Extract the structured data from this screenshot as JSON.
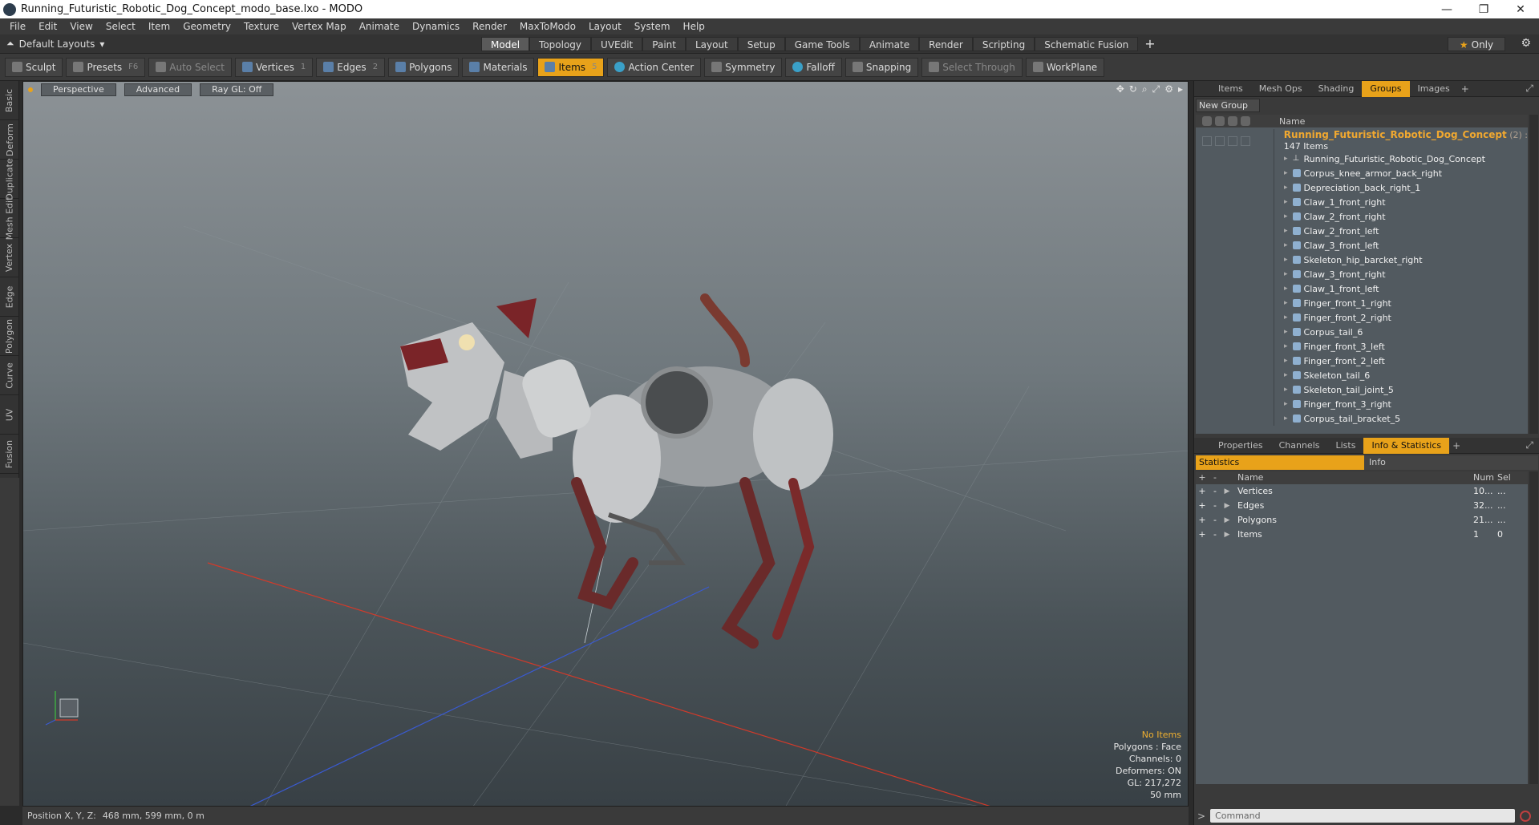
{
  "window": {
    "title": "Running_Futuristic_Robotic_Dog_Concept_modo_base.lxo - MODO",
    "minimize": "—",
    "maximize": "❐",
    "close": "✕"
  },
  "menu": [
    "File",
    "Edit",
    "View",
    "Select",
    "Item",
    "Geometry",
    "Texture",
    "Vertex Map",
    "Animate",
    "Dynamics",
    "Render",
    "MaxToModo",
    "Layout",
    "System",
    "Help"
  ],
  "layoutbar": {
    "layouts_label": "Default Layouts",
    "tabs": [
      "Model",
      "Topology",
      "UVEdit",
      "Paint",
      "Layout",
      "Setup",
      "Game Tools",
      "Animate",
      "Render",
      "Scripting",
      "Schematic Fusion"
    ],
    "active_tab": "Model",
    "plus": "+",
    "only_label": "Only",
    "only_star": "★"
  },
  "toolbar": {
    "sculpt": "Sculpt",
    "presets": "Presets",
    "presets_key": "F6",
    "auto_select": "Auto Select",
    "vertices": "Vertices",
    "vertices_key": "1",
    "edges": "Edges",
    "edges_key": "2",
    "polygons": "Polygons",
    "materials": "Materials",
    "items": "Items",
    "items_key": "5",
    "action_center": "Action Center",
    "symmetry": "Symmetry",
    "falloff": "Falloff",
    "snapping": "Snapping",
    "select_through": "Select Through",
    "workplane": "WorkPlane"
  },
  "left_tabs": [
    "Basic",
    "Deform",
    "Duplicate",
    "Mesh Edit",
    "Vertex",
    "Edge",
    "Polygon",
    "Curve",
    "UV",
    "Fusion"
  ],
  "viewport": {
    "view_mode": "Perspective",
    "shading": "Advanced",
    "raygl": "Ray GL: Off",
    "info": {
      "selection": "No Items",
      "polygons": "Polygons : Face",
      "channels": "Channels: 0",
      "deformers": "Deformers: ON",
      "gl": "GL: 217,272",
      "focal": "50 mm"
    }
  },
  "status": {
    "position_label": "Position X, Y, Z:",
    "position_value": "468 mm, 599 mm, 0 m"
  },
  "groups_panel": {
    "tabs": [
      "Items",
      "Mesh Ops",
      "Shading",
      "Groups",
      "Images"
    ],
    "active_tab": "Groups",
    "new_group": "New Group",
    "column_name": "Name",
    "group_name": "Running_Futuristic_Robotic_Dog_Concept",
    "group_count": "(2) :",
    "group_items": "147 Items",
    "items": [
      "Running_Futuristic_Robotic_Dog_Concept",
      "Corpus_knee_armor_back_right",
      "Depreciation_back_right_1",
      "Claw_1_front_right",
      "Claw_2_front_right",
      "Claw_2_front_left",
      "Claw_3_front_left",
      "Skeleton_hip_barcket_right",
      "Claw_3_front_right",
      "Claw_1_front_left",
      "Finger_front_1_right",
      "Finger_front_2_right",
      "Corpus_tail_6",
      "Finger_front_3_left",
      "Finger_front_2_left",
      "Skeleton_tail_6",
      "Skeleton_tail_joint_5",
      "Finger_front_3_right",
      "Corpus_tail_bracket_5"
    ]
  },
  "stats_panel": {
    "tabs": [
      "Properties",
      "Channels",
      "Lists",
      "Info & Statistics"
    ],
    "active_tab": "Info & Statistics",
    "sub_statistics": "Statistics",
    "sub_info": "Info",
    "col_name": "Name",
    "col_num": "Num",
    "col_sel": "Sel",
    "rows": [
      {
        "name": "Vertices",
        "num": "10...",
        "sel": "..."
      },
      {
        "name": "Edges",
        "num": "32...",
        "sel": "..."
      },
      {
        "name": "Polygons",
        "num": "21...",
        "sel": "..."
      },
      {
        "name": "Items",
        "num": "1",
        "sel": "0"
      }
    ]
  },
  "command": {
    "prompt": ">",
    "placeholder": "Command"
  }
}
